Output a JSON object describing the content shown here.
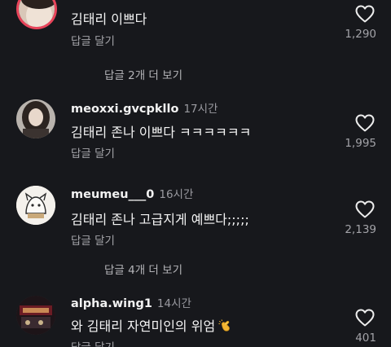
{
  "comments": [
    {
      "username": "",
      "time": "",
      "text": "김태리 이쁘다",
      "reply_label": "답글 달기",
      "likes": "1,290"
    },
    {
      "username": "meoxxi.gvcpkllo",
      "time": "17시간",
      "text": "김태리 존나 이쁘다 ㅋㅋㅋㅋㅋㅋ",
      "reply_label": "답글 달기",
      "likes": "1,995"
    },
    {
      "username": "meumeu___0",
      "time": "16시간",
      "text": "김태리 존나 고급지게 예쁘다;;;;;",
      "reply_label": "답글 달기",
      "likes": "2,139"
    },
    {
      "username": "alpha.wing1",
      "time": "14시간",
      "text": "와 김태리 자연미인의 위엄",
      "reply_label": "답글 달기",
      "likes": "401"
    }
  ],
  "more_replies": [
    {
      "label": "답글 2개 더 보기"
    },
    {
      "label": "답글 4개 더 보기"
    }
  ],
  "icons": {
    "like": "heart-outline-icon",
    "emoji": "clapping-hands-emoji"
  },
  "colors": {
    "background": "#17181c",
    "story_ring": "#e8445a",
    "secondary_text": "#a3a3a8"
  }
}
